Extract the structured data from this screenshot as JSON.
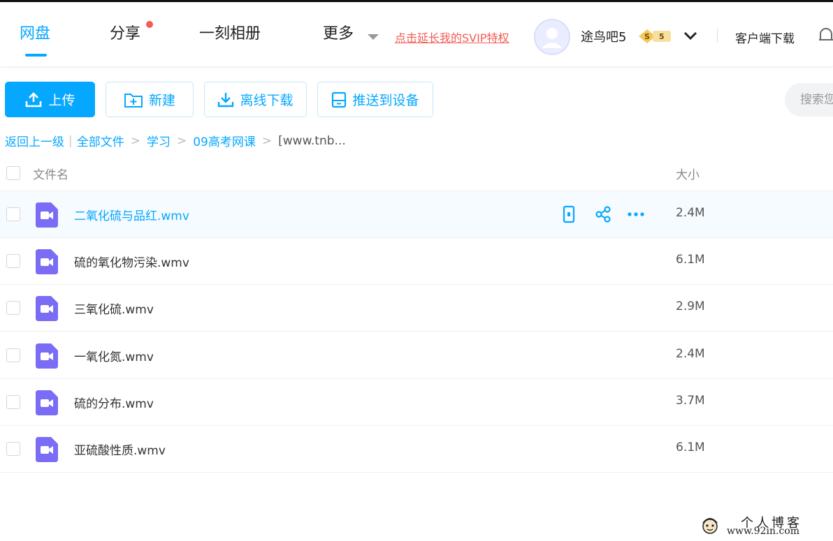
{
  "header": {
    "nav": [
      {
        "label": "网盘",
        "active": true
      },
      {
        "label": "分享",
        "badge": "red-dot"
      },
      {
        "label": "一刻相册"
      },
      {
        "label": "更多"
      }
    ],
    "svip_link": "点击延长我的SVIP特权",
    "username": "途鸟吧5",
    "vip_level": "5",
    "client_download": "客户端下载",
    "accent": "#06a7ff",
    "promo_color": "#f25c54"
  },
  "toolbar": {
    "upload": "上传",
    "new": "新建",
    "offline_download": "离线下载",
    "push_device": "推送到设备",
    "search_placeholder": "搜索您"
  },
  "breadcrumb": {
    "back": "返回上一级",
    "items": [
      "全部文件",
      "学习",
      "09高考网课"
    ],
    "current": "[www.tnb..."
  },
  "table": {
    "headers": {
      "name": "文件名",
      "size": "大小"
    },
    "rows": [
      {
        "name": "二氧化硫与品红.wmv",
        "size": "2.4M",
        "hover": true
      },
      {
        "name": "硫的氧化物污染.wmv",
        "size": "6.1M"
      },
      {
        "name": "三氧化硫.wmv",
        "size": "2.9M"
      },
      {
        "name": "一氧化氮.wmv",
        "size": "2.4M"
      },
      {
        "name": "硫的分布.wmv",
        "size": "3.7M"
      },
      {
        "name": "亚硫酸性质.wmv",
        "size": "6.1M"
      }
    ]
  },
  "watermark": {
    "line1": "个人博客",
    "line2": "www.92in.com"
  }
}
